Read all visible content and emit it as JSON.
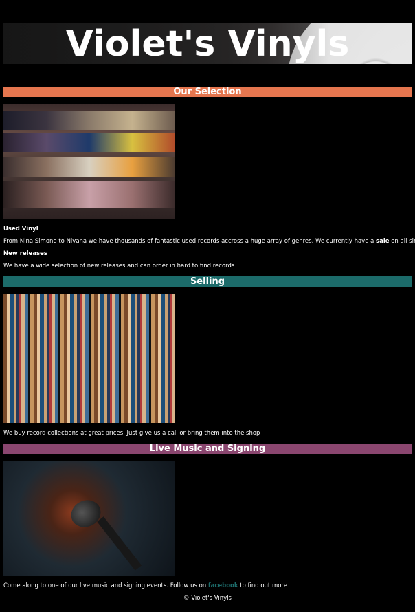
{
  "header": {
    "title": "Violet's Vinyls"
  },
  "sections": {
    "selection": {
      "title": "Our Selection",
      "image_alt_icon": "record-crates-photo",
      "used_heading": "Used Vinyl",
      "used_text_before": "From Nina Simone to Nivana we have thousands of fantastic used records accross a huge array of genres. We currently have a",
      "used_text_bold": "sale",
      "used_text_after": "on all singles.",
      "new_heading": "New releases",
      "new_text": "We have a wide selection of new releases and can order in hard to find records"
    },
    "selling": {
      "title": "Selling",
      "image_alt_icon": "record-spines-photo",
      "text": "We buy record collections at great prices. Just give us a call or bring them into the shop"
    },
    "live": {
      "title": "Live Music and Signing",
      "image_alt_icon": "microphone-photo",
      "text_before": "Come along to one of our live music and signing events. Follow us on",
      "link_label": "facebook",
      "text_after": "to find out more"
    }
  },
  "footer": {
    "text": "© Violet's Vinyls"
  },
  "colors": {
    "background": "#000000",
    "selection_bar": "#e5764f",
    "selling_bar": "#1c6b6a",
    "live_bar": "#8a466f",
    "link": "#1c6b6a"
  }
}
